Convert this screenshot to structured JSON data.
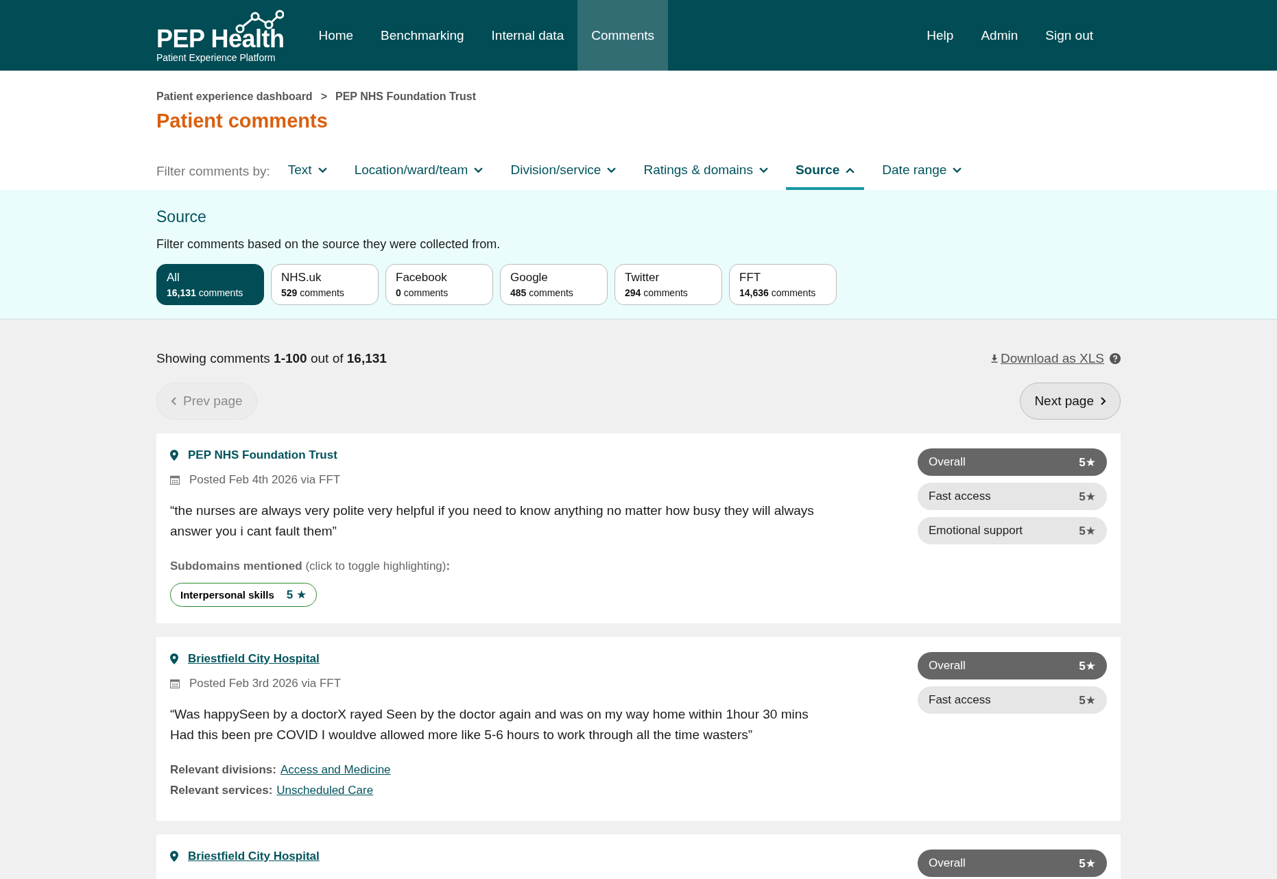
{
  "header": {
    "logo": {
      "title": "PEP Health",
      "subtitle": "Patient Experience Platform"
    },
    "nav": [
      {
        "label": "Home",
        "selected": false
      },
      {
        "label": "Benchmarking",
        "selected": false
      },
      {
        "label": "Internal data",
        "selected": false
      },
      {
        "label": "Comments",
        "selected": true
      }
    ],
    "account_nav": [
      "Help",
      "Admin",
      "Sign out"
    ]
  },
  "breadcrumb": {
    "items": [
      "Patient experience dashboard",
      "PEP NHS Foundation Trust"
    ],
    "separator": ">"
  },
  "title": "Patient comments",
  "filters": {
    "label": "Filter comments by:",
    "items": [
      {
        "label": "Text",
        "selected": false
      },
      {
        "label": "Location/ward/team",
        "selected": false
      },
      {
        "label": "Division/service",
        "selected": false
      },
      {
        "label": "Ratings & domains",
        "selected": false
      },
      {
        "label": "Source",
        "selected": true
      },
      {
        "label": "Date range",
        "selected": false
      }
    ]
  },
  "source_panel": {
    "heading": "Source",
    "description": "Filter comments based on the source they were collected from.",
    "options": [
      {
        "name": "All",
        "count": "**16,131** comments",
        "selected": true
      },
      {
        "name": "NHS.uk",
        "count": "**529** comments",
        "selected": false
      },
      {
        "name": "Facebook",
        "count": "**0** comments",
        "selected": false
      },
      {
        "name": "Google",
        "count": "**485** comments",
        "selected": false
      },
      {
        "name": "Twitter",
        "count": "**294** comments",
        "selected": false
      },
      {
        "name": "FFT",
        "count": "**14,636** comments",
        "selected": false
      }
    ]
  },
  "results": {
    "summary": "Showing comments **1-100** out of **16,131**",
    "download": "Download as XLS",
    "prev": {
      "label": "Prev page",
      "disabled": true
    },
    "next": {
      "label": "Next page",
      "disabled": false
    }
  },
  "comments": [
    {
      "location": "PEP NHS Foundation Trust",
      "location_link": false,
      "posted": "Posted Feb 4th 2026 via FFT",
      "text": "“the nurses are always very polite very helpful if you need to know anything no matter how busy they will always answer you i cant fault them”",
      "ratings": [
        {
          "kind": "overall",
          "label": "Overall",
          "value": "5★"
        },
        {
          "kind": "domain",
          "label": "Fast access",
          "value": "5★"
        },
        {
          "kind": "domain",
          "label": "Emotional support",
          "value": "5★"
        }
      ],
      "subdomains": {
        "label": "**Subdomains mentioned** (click to toggle highlighting)**:**",
        "items": [
          {
            "label": "Interpersonal skills",
            "rating": "5 ★"
          }
        ]
      }
    },
    {
      "location": "Briestfield City Hospital",
      "location_link": true,
      "posted": "Posted Feb 3rd 2026 via FFT",
      "text": "“Was happySeen by a doctorX rayed Seen by the doctor again and was on my way home within 1hour 30 mins\nHad this been pre COVID I wouldve allowed more like 5-6 hours to work through all the time wasters”",
      "ratings": [
        {
          "kind": "overall",
          "label": "Overall",
          "value": "5★"
        },
        {
          "kind": "domain",
          "label": "Fast access",
          "value": "5★"
        }
      ],
      "relevant": [
        {
          "label": "Relevant divisions:",
          "link": "Access and Medicine"
        },
        {
          "label": "Relevant services:",
          "link": "Unscheduled Care"
        }
      ]
    },
    {
      "location": "Briestfield City Hospital",
      "location_link": true,
      "ratings": [
        {
          "kind": "overall",
          "label": "Overall",
          "value": "5★"
        }
      ]
    }
  ]
}
